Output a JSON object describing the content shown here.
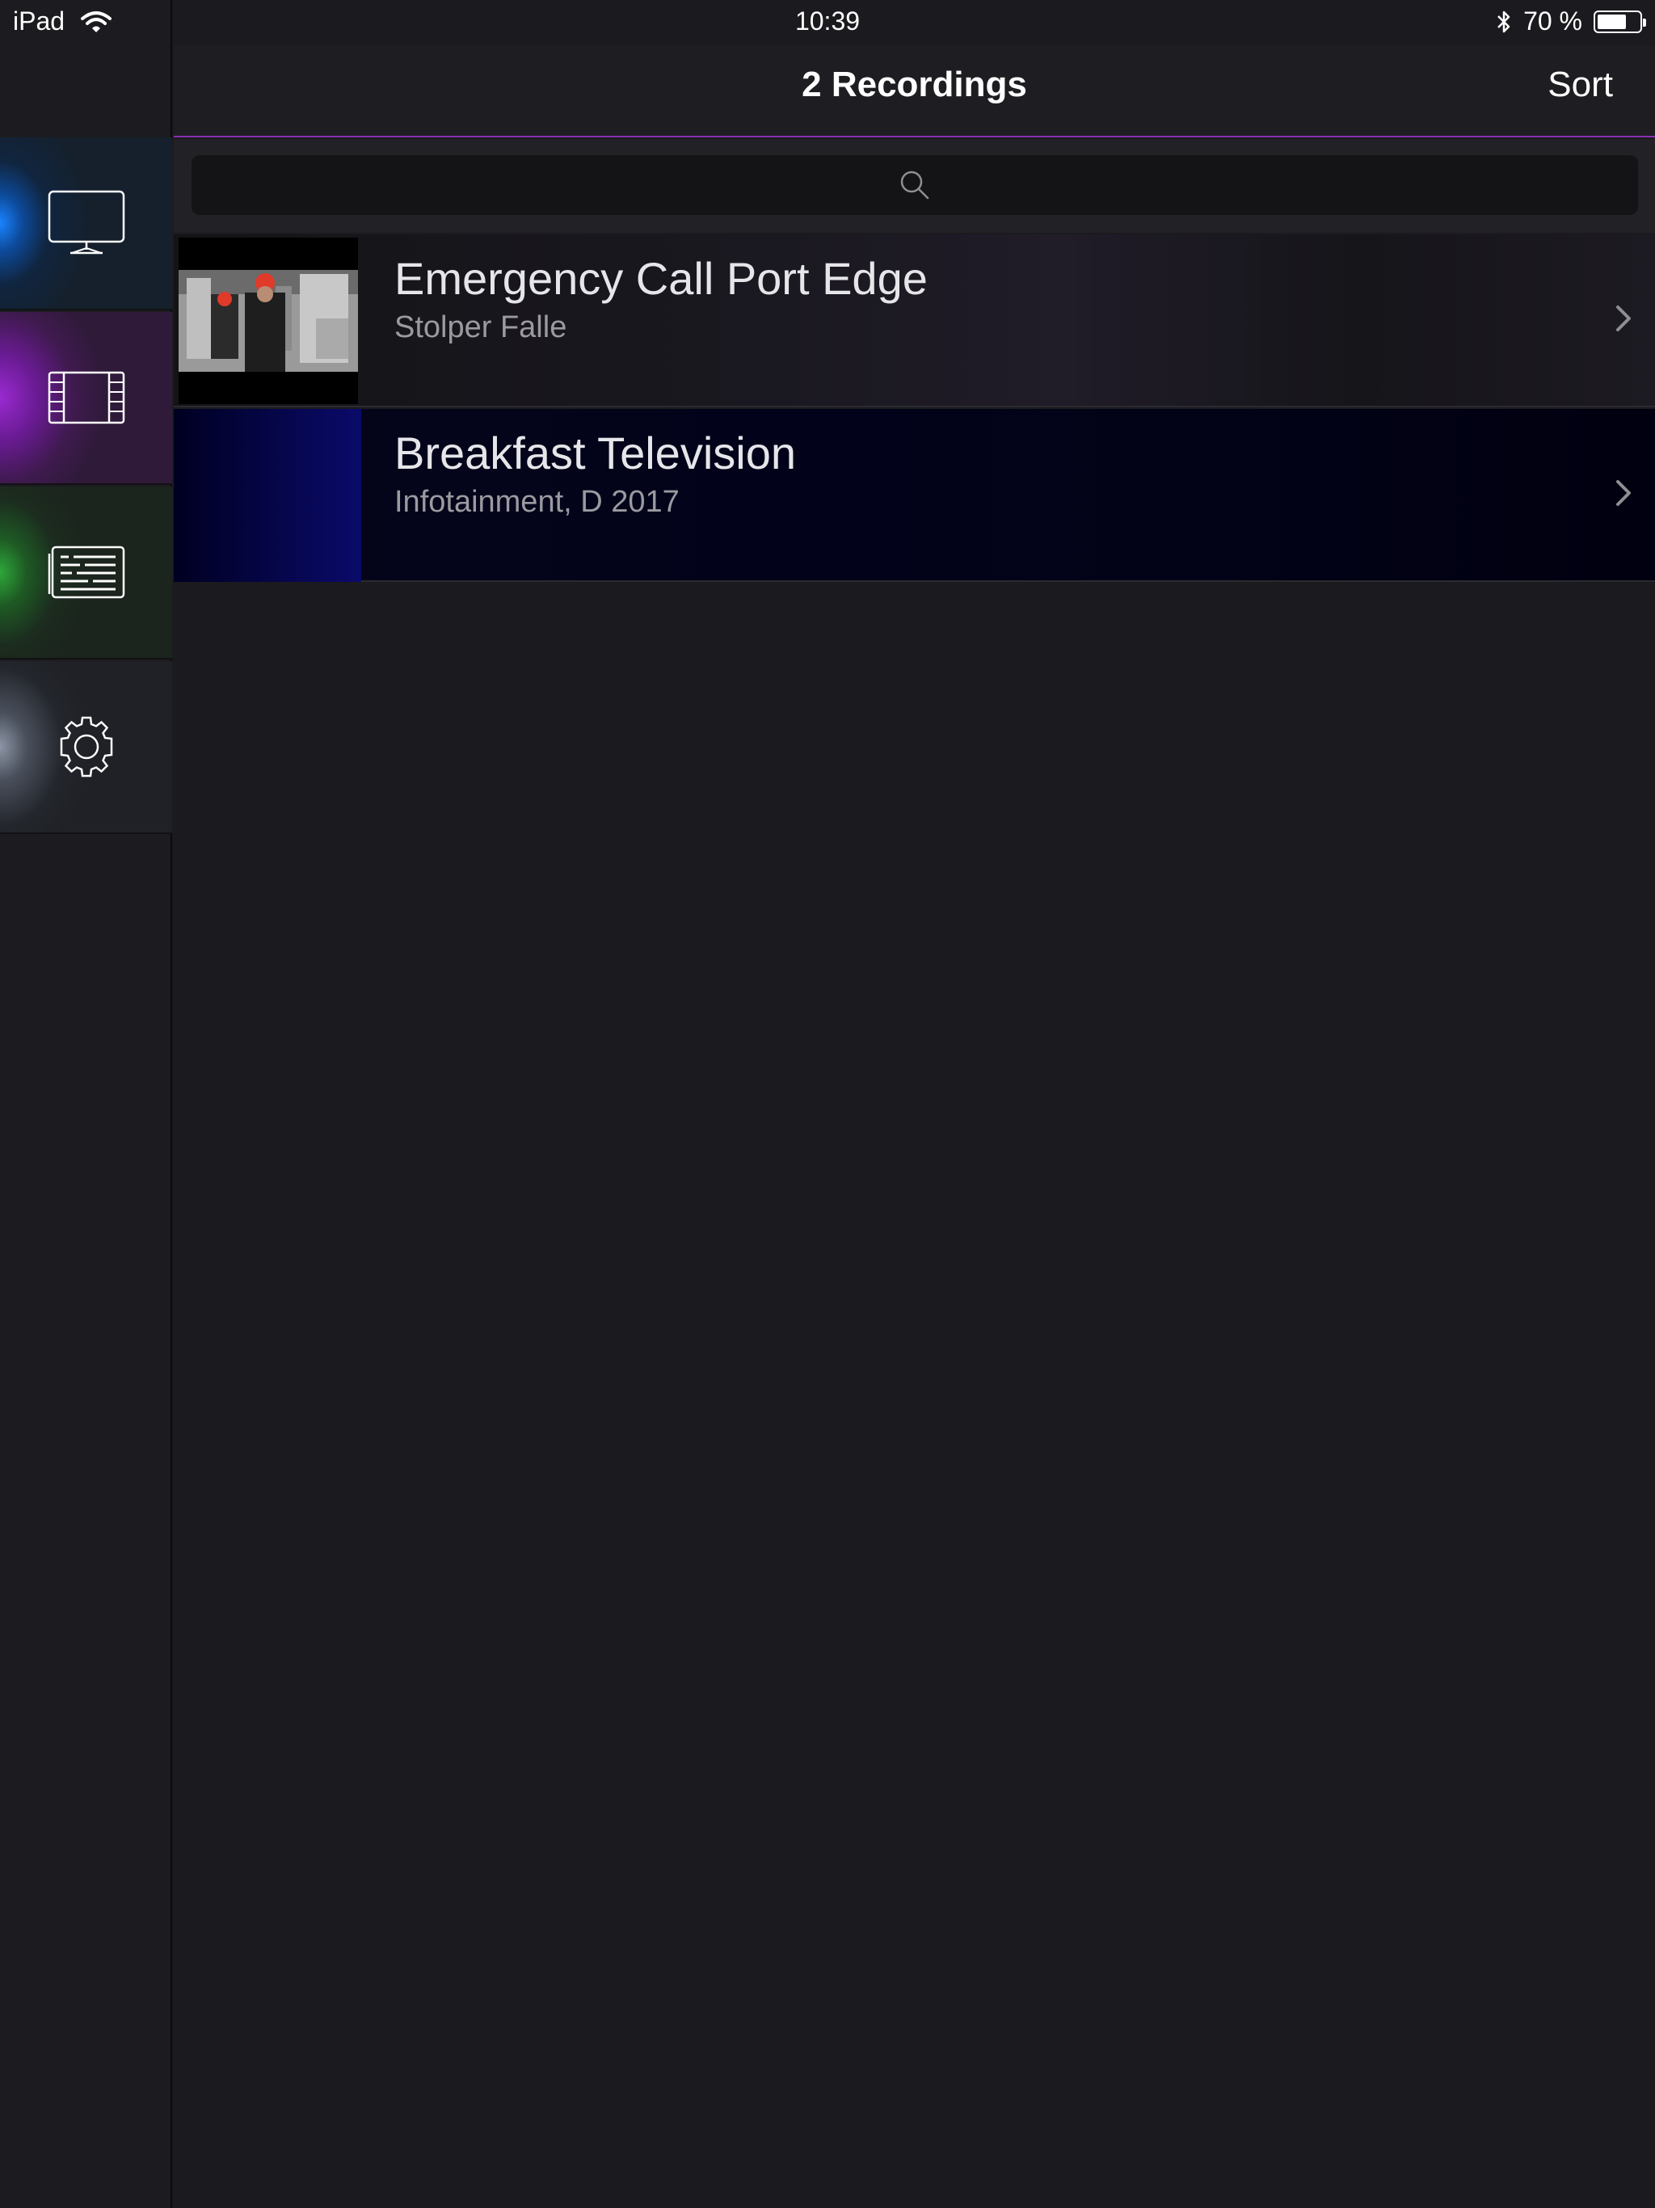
{
  "status_bar": {
    "device": "iPad",
    "time": "10:39",
    "battery": "70 %",
    "battery_level": 0.7
  },
  "sidebar": {
    "items": [
      {
        "name": "tv",
        "icon": "tv-icon"
      },
      {
        "name": "movies",
        "icon": "film-icon"
      },
      {
        "name": "guide",
        "icon": "guide-icon"
      },
      {
        "name": "settings",
        "icon": "gear-icon"
      }
    ]
  },
  "nav": {
    "title": "2 Recordings",
    "sort_label": "Sort",
    "accent_color": "#8a2fb0"
  },
  "search": {
    "placeholder": ""
  },
  "recordings": [
    {
      "title": "Emergency Call Port Edge",
      "subtitle": "Stolper Falle"
    },
    {
      "title": "Breakfast Television",
      "subtitle": "Infotainment, D 2017"
    }
  ]
}
